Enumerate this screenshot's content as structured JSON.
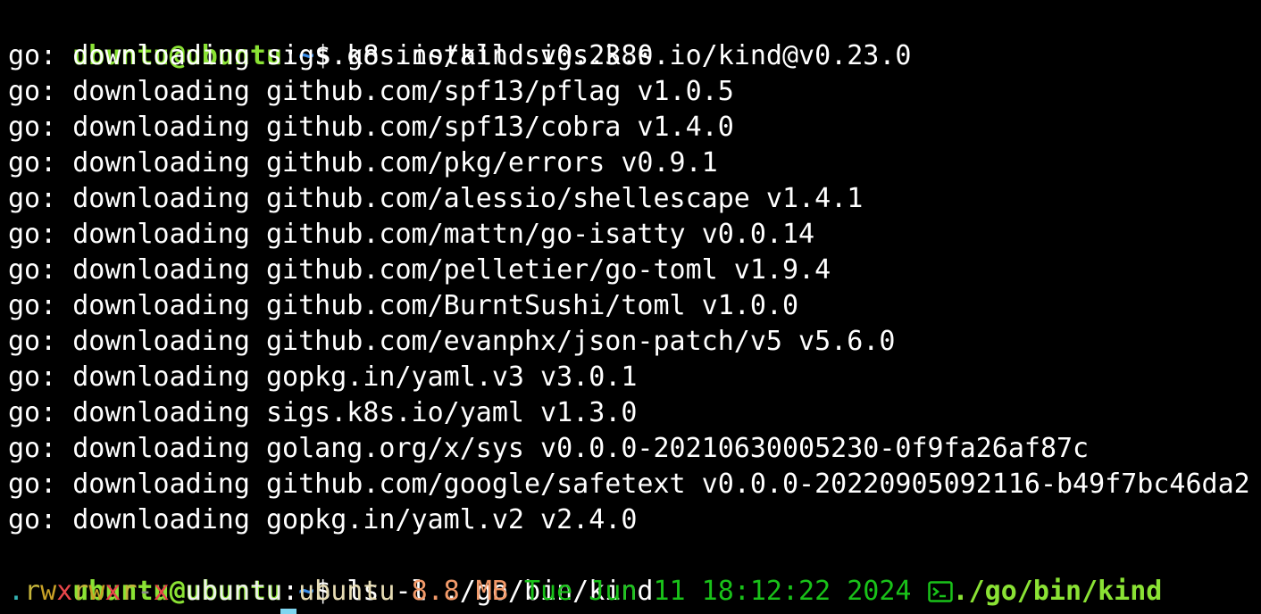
{
  "prompt": {
    "user_host": "ubuntu@ubuntu",
    "colon": ":",
    "path": "~",
    "dollar": "$ "
  },
  "commands": [
    "go install sigs.k8s.io/kind@v0.23.0",
    "ls -l ./go/bin/kind"
  ],
  "output_lines": [
    "go: downloading sigs.k8s.io/kind v0.23.0",
    "go: downloading github.com/spf13/pflag v1.0.5",
    "go: downloading github.com/spf13/cobra v1.4.0",
    "go: downloading github.com/pkg/errors v0.9.1",
    "go: downloading github.com/alessio/shellescape v1.4.1",
    "go: downloading github.com/mattn/go-isatty v0.0.14",
    "go: downloading github.com/pelletier/go-toml v1.9.4",
    "go: downloading github.com/BurntSushi/toml v1.0.0",
    "go: downloading github.com/evanphx/json-patch/v5 v5.6.0",
    "go: downloading gopkg.in/yaml.v3 v3.0.1",
    "go: downloading sigs.k8s.io/yaml v1.3.0",
    "go: downloading golang.org/x/sys v0.0.0-20210630005230-0f9fa26af87c",
    "go: downloading github.com/google/safetext v0.0.0-20220905092116-b49f7bc46da2",
    "go: downloading gopkg.in/yaml.v2 v2.4.0"
  ],
  "ls_entry": {
    "perm_type": ".",
    "perm_1": "r",
    "perm_2": "w",
    "perm_3": "x",
    "perm_4": "r",
    "perm_5": "w",
    "perm_6": "x",
    "perm_7": "r",
    "perm_8": "-",
    "perm_9": "x",
    "owner": "ubuntu",
    "group": "ubuntu",
    "size": "8.8 MB",
    "date": "Tue Jun 11 18:12:22 2024",
    "icon": "terminal-icon",
    "name": "./go/bin/kind"
  },
  "colors": {
    "background": "#000000",
    "prompt_user": "#8ae234",
    "prompt_path": "#3b8eea",
    "date": "#19c219",
    "size": "#f29a6a",
    "cursor": "#7fd6f0"
  }
}
